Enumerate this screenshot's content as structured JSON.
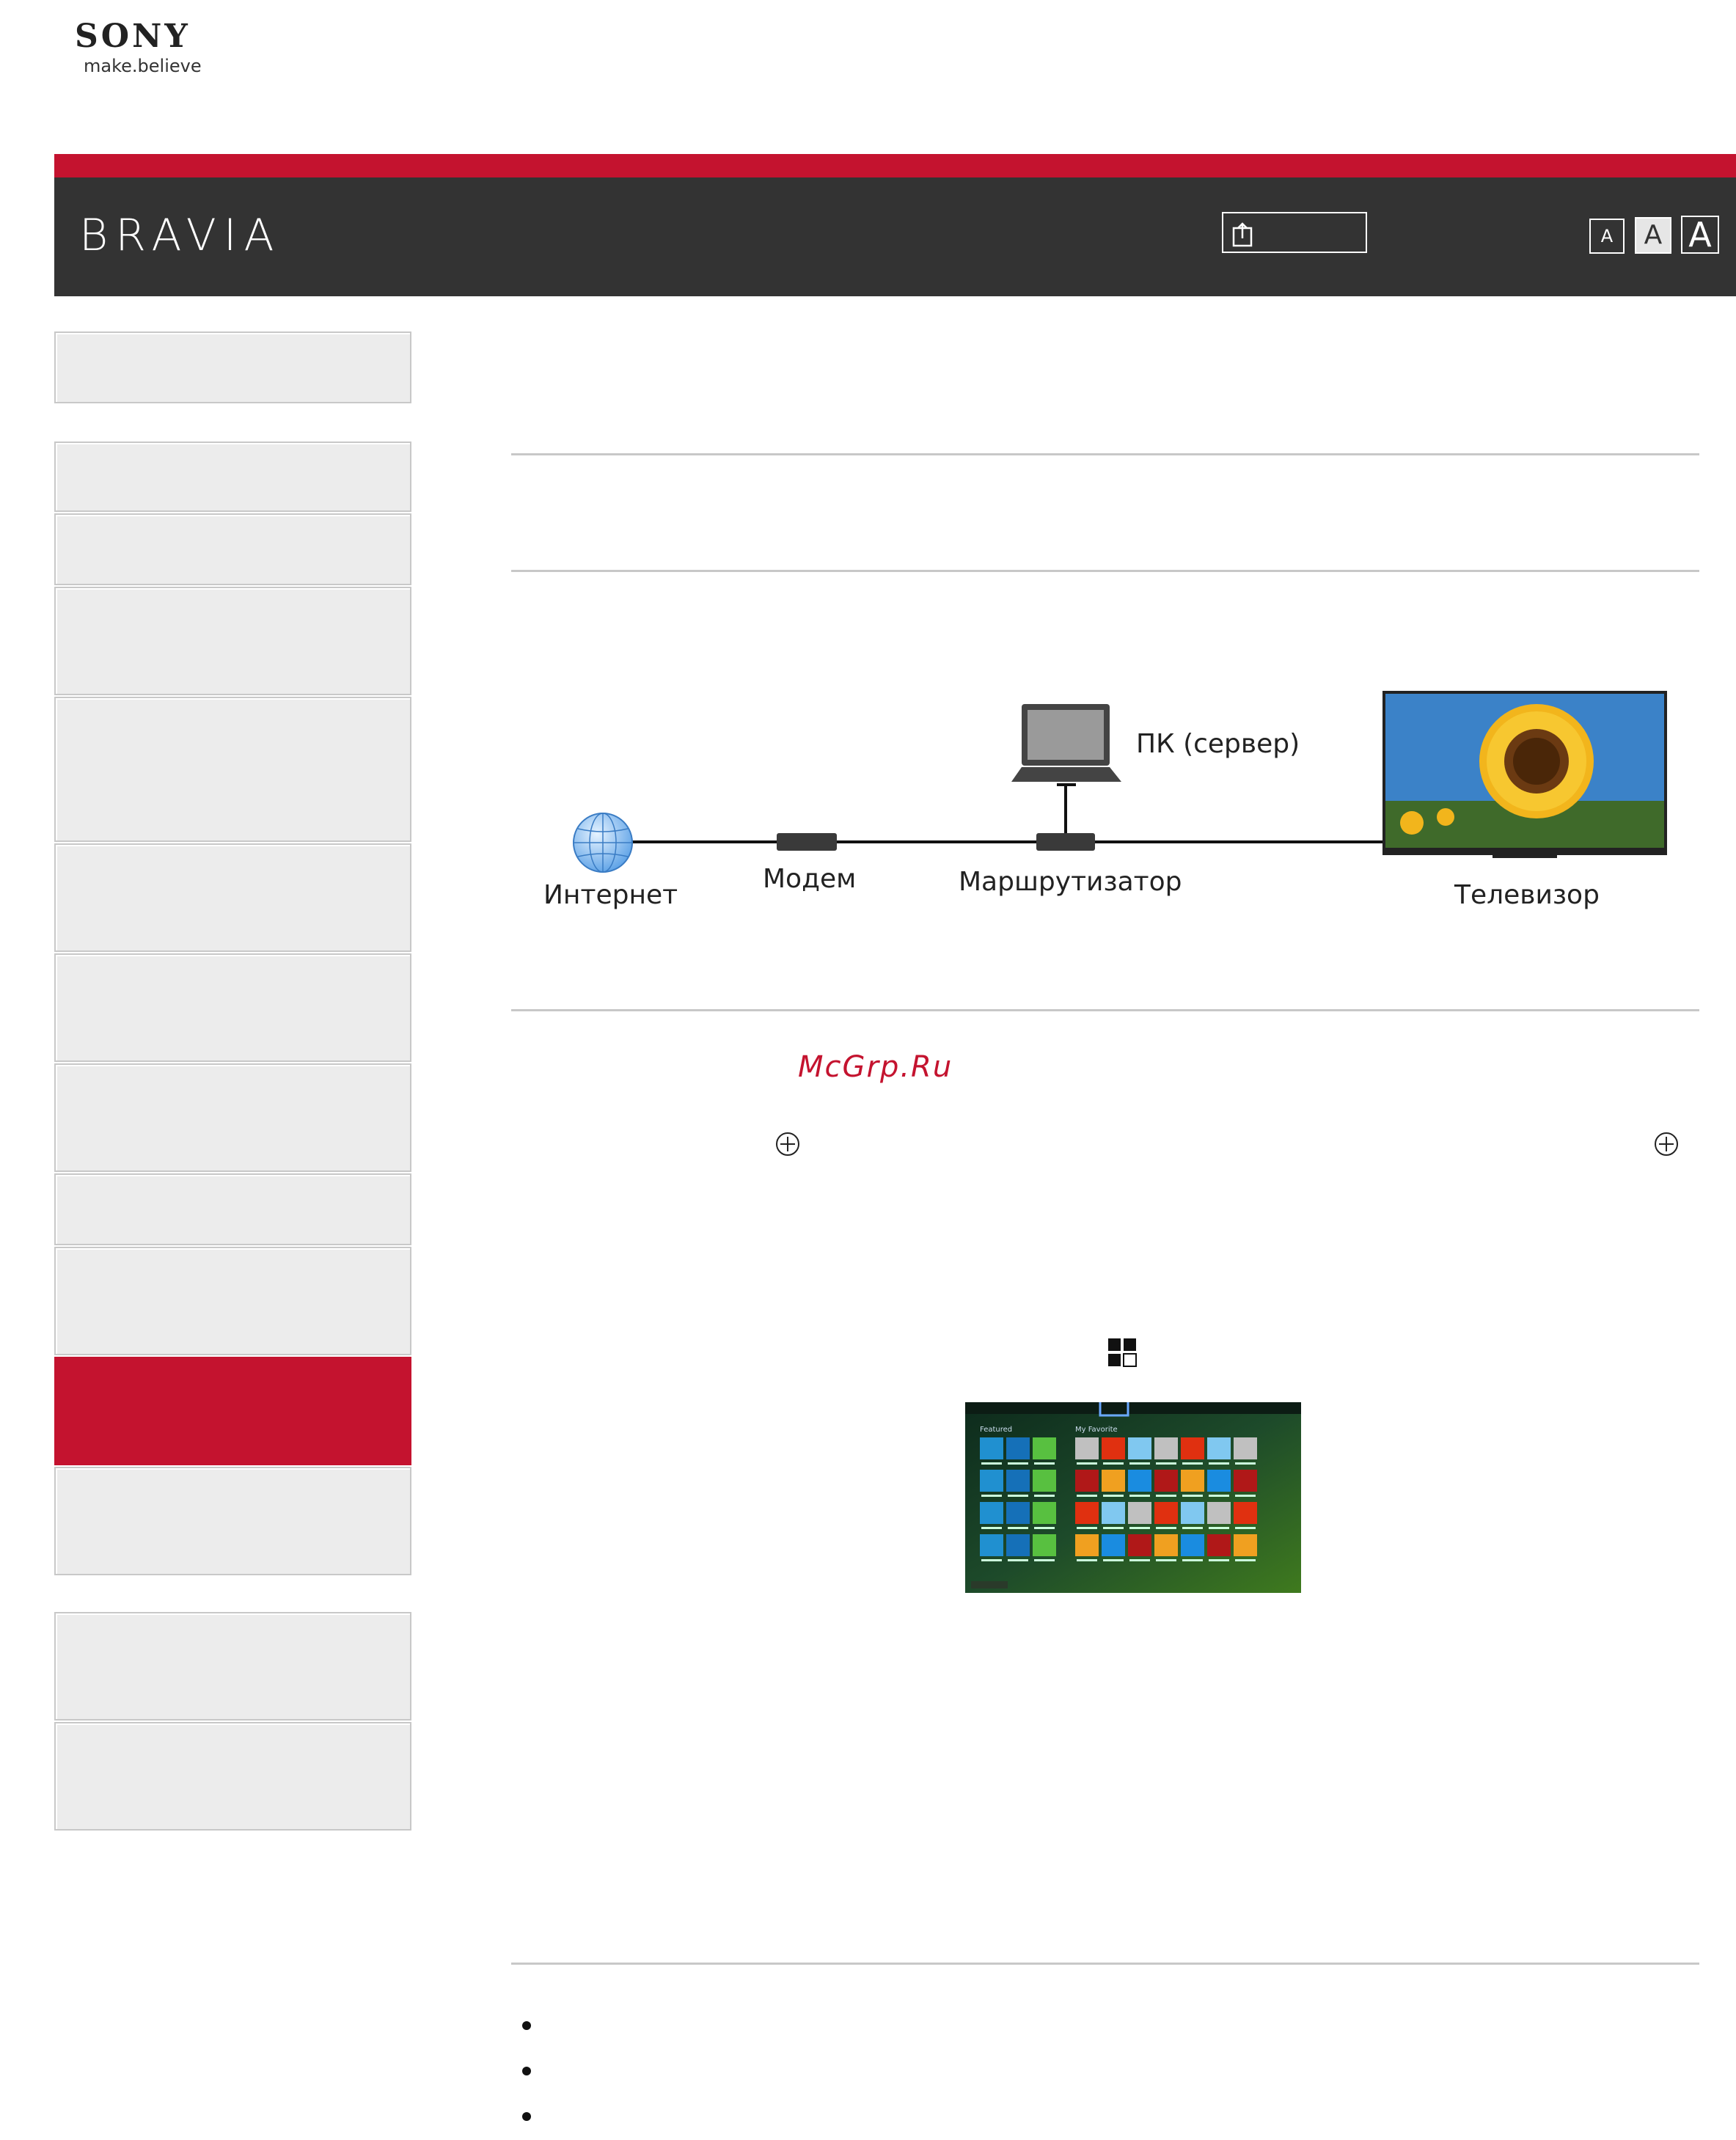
{
  "brand": {
    "name": "SONY",
    "tagline": "make.believe"
  },
  "header": {
    "product": "BRAVIA",
    "font_size_buttons": [
      "A",
      "A",
      "A"
    ]
  },
  "sidebar": {
    "items": [
      {
        "active": false
      },
      {
        "active": false
      },
      {
        "active": false
      },
      {
        "active": false
      },
      {
        "active": false
      },
      {
        "active": false
      },
      {
        "active": false
      },
      {
        "active": false
      },
      {
        "active": false
      },
      {
        "active": false
      },
      {
        "active": true
      },
      {
        "active": false
      },
      {
        "active": false
      },
      {
        "active": false
      }
    ]
  },
  "diagram": {
    "labels": {
      "internet": "Интернет",
      "modem": "Модем",
      "router": "Маршрутизатор",
      "pc": "ПК (сервер)",
      "tv": "Телевизор"
    }
  },
  "watermark": "McGrp.Ru",
  "icons": [
    "plus-circle-icon",
    "app-grid-icon",
    "share-icon"
  ],
  "colors": {
    "accent": "#c4132f",
    "header_bg": "#333333",
    "sidebar_bg": "#ececec"
  },
  "tv_screen": {
    "sections": [
      "Featured",
      "My Favorite"
    ]
  },
  "bullets": 3
}
